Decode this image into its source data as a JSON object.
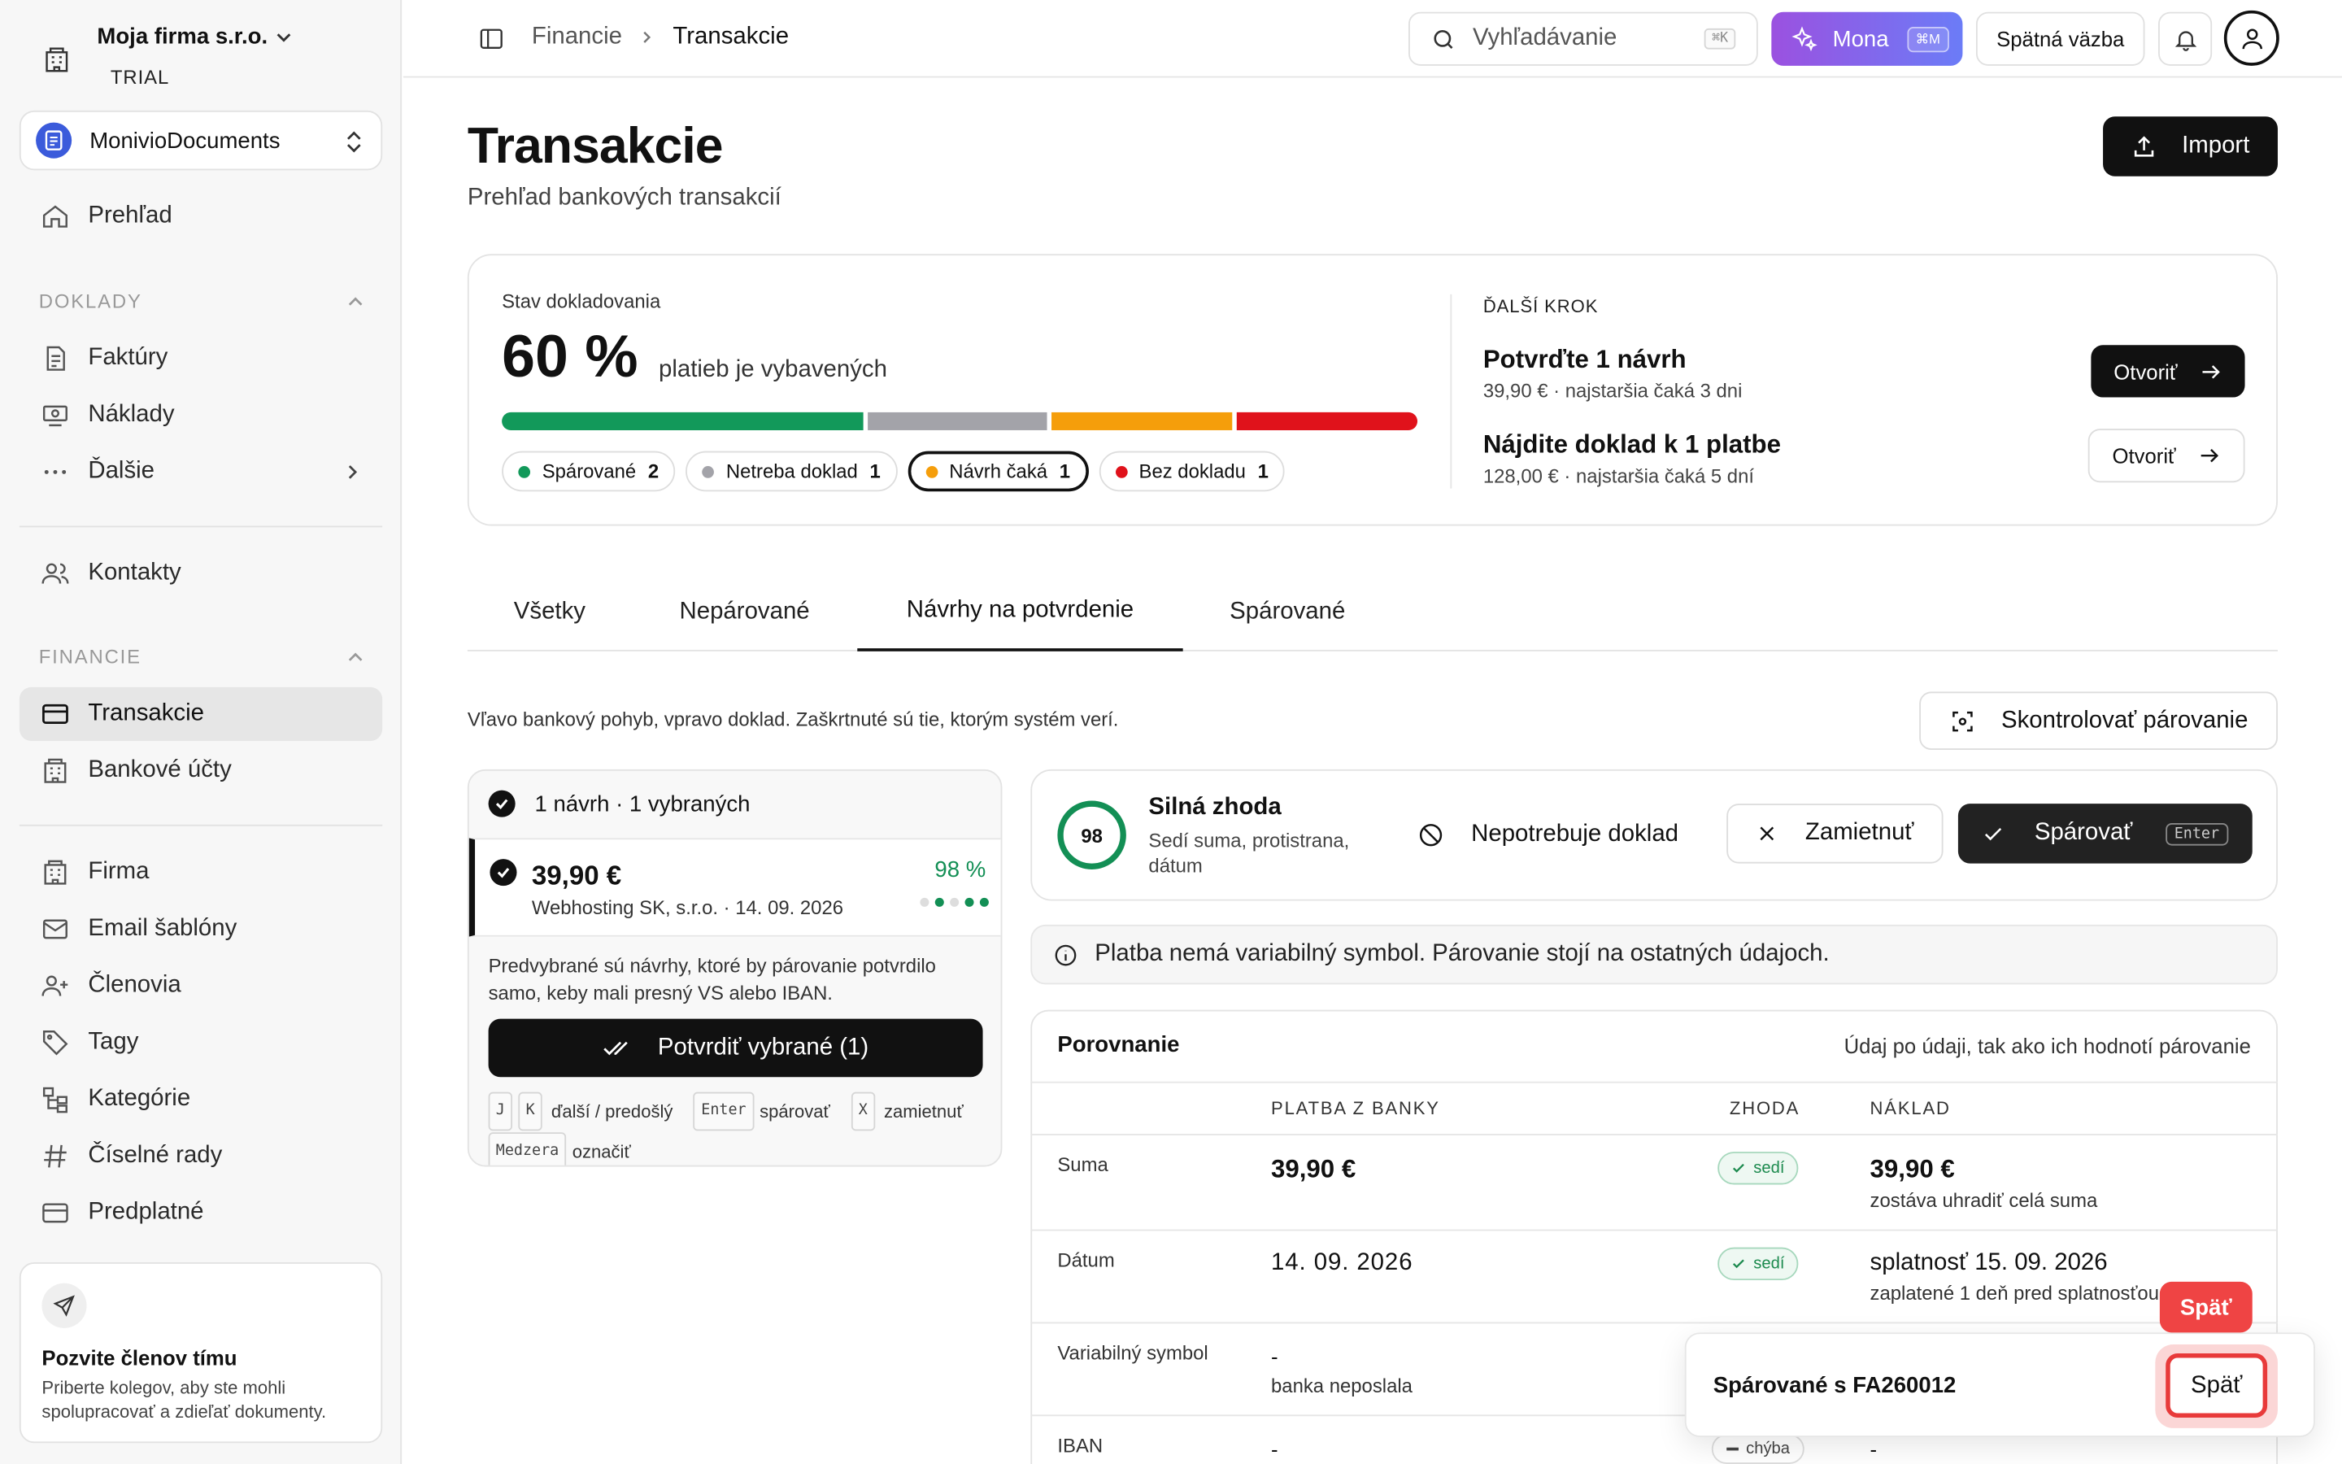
{
  "company": {
    "name": "Moja firma s.r.o.",
    "plan": "TRIAL"
  },
  "workspace": {
    "name": "MonivioDocuments"
  },
  "nav": {
    "overview": "Prehľad",
    "doklady_header": "DOKLADY",
    "faktury": "Faktúry",
    "naklady": "Náklady",
    "dalsie": "Ďalšie",
    "kontakty": "Kontakty",
    "financie_header": "FINANCIE",
    "transakcie": "Transakcie",
    "bankove_ucty": "Bankové účty",
    "firma": "Firma",
    "email_sablony": "Email šablóny",
    "clenovia": "Členovia",
    "tagy": "Tagy",
    "kategorie": "Kategórie",
    "ciselne_rady": "Číselné rady",
    "predplatne": "Predplatné"
  },
  "invite": {
    "title": "Pozvite členov tímu",
    "text": "Priberte kolegov, aby ste mohli spolupracovať a zdieľať dokumenty."
  },
  "topbar": {
    "breadcrumb_parent": "Financie",
    "breadcrumb_current": "Transakcie",
    "search_placeholder": "Vyhľadávanie",
    "search_kbd": "⌘K",
    "mona_label": "Mona",
    "mona_kbd": "⌘M",
    "feedback_label": "Spätná väzba"
  },
  "page": {
    "title": "Transakcie",
    "subtitle": "Prehľad bankových transakcií",
    "import_label": "Import"
  },
  "status": {
    "label": "Stav dokladovania",
    "percent": "60 %",
    "percent_text": "platieb je vybavených",
    "segments": [
      {
        "name": "Spárované",
        "count": "2",
        "fraction": 0.4,
        "color": "#12995a"
      },
      {
        "name": "Netreba doklad",
        "count": "1",
        "fraction": 0.2,
        "color": "#a3a3a9"
      },
      {
        "name": "Návrh čaká",
        "count": "1",
        "fraction": 0.2,
        "color": "#f59e0b"
      },
      {
        "name": "Bez dokladu",
        "count": "1",
        "fraction": 0.2,
        "color": "#e0121b"
      }
    ]
  },
  "next_step": {
    "header": "ĎALŠÍ KROK",
    "item1_title": "Potvrďte 1 návrh",
    "item1_sub": "39,90 € · najstaršia čaká 3 dni",
    "item1_button": "Otvoriť",
    "item2_title": "Nájdite doklad k 1 platbe",
    "item2_sub": "128,00 € · najstaršia čaká 5 dní",
    "item2_button": "Otvoriť"
  },
  "tabs": [
    "Všetky",
    "Nepárované",
    "Návrhy na potvrdenie",
    "Spárované"
  ],
  "active_tab": "Návrhy na potvrdenie",
  "hint": "Vľavo bankový pohyb, vpravo doklad. Zaškrtnuté sú tie, ktorým systém verí.",
  "check_button": "Skontrolovať párovanie",
  "proposals": {
    "header": "1 návrh · 1 vybraných",
    "amount": "39,90 €",
    "detail": "Webhosting SK, s.r.o. · 14. 09. 2026",
    "score": "98 %",
    "note": "Predvybrané sú návrhy, ktoré by párovanie potvrdilo samo, keby mali presný VS alebo IBAN.",
    "confirm_button": "Potvrdiť vybrané (1)",
    "kb_j": "J",
    "kb_k": "K",
    "kb_nav_text": "ďalší / predošlý",
    "kb_enter": "Enter",
    "kb_enter_text": "spárovať",
    "kb_x": "X",
    "kb_x_text": "zamietnuť",
    "kb_space": "Medzera",
    "kb_space_text": "označiť"
  },
  "match": {
    "score": "98",
    "title": "Silná zhoda",
    "sub": "Sedí suma, protistrana, dátum",
    "no_doc_button": "Nepotrebuje doklad",
    "reject_button": "Zamietnuť",
    "pair_button": "Spárovať",
    "pair_kbd": "Enter"
  },
  "info_banner": "Platba nemá variabilný symbol. Párovanie stojí na ostatných údajoch.",
  "comparison": {
    "title": "Porovnanie",
    "subtitle": "Údaj po údaji, tak ako ich hodnotí párovanie",
    "col_bank": "PLATBA Z BANKY",
    "col_match": "ZHODA",
    "col_cost": "NÁKLAD",
    "rows": [
      {
        "label": "Suma",
        "bank": "39,90 €",
        "bank_sub": "",
        "match": "sedí",
        "cost": "39,90 €",
        "cost_sub": "zostáva uhradiť celá suma"
      },
      {
        "label": "Dátum",
        "bank": "14. 09. 2026",
        "bank_sub": "",
        "match": "sedí",
        "cost": "splatnosť 15. 09. 2026",
        "cost_sub": "zaplatené 1 deň pred splatnosťou"
      },
      {
        "label": "Variabilný symbol",
        "bank": "-",
        "bank_sub": "banka neposlala",
        "match": "",
        "cost": "",
        "cost_sub": ""
      },
      {
        "label": "IBAN",
        "bank": "-",
        "bank_sub": "",
        "match": "chýba",
        "cost": "-",
        "cost_sub": ""
      }
    ]
  },
  "toast": {
    "text": "Spárované s FA260012",
    "undo_button": "Späť",
    "tooltip": "Späť"
  }
}
